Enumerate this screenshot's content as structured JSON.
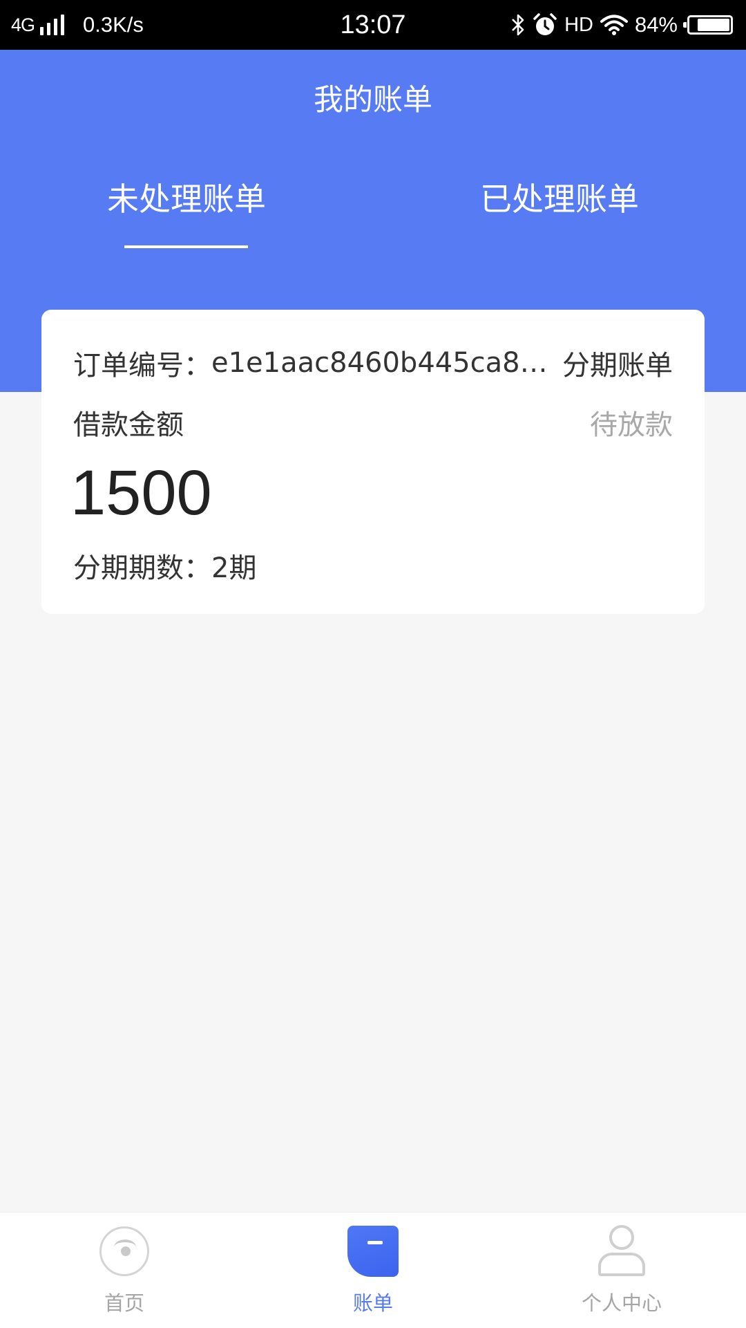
{
  "status_bar": {
    "network": "4G",
    "speed": "0.3K/s",
    "time": "13:07",
    "hd": "HD",
    "battery": "84%",
    "battery_level": 0.84
  },
  "header": {
    "title": "我的账单",
    "tabs": [
      {
        "label": "未处理账单",
        "active": true
      },
      {
        "label": "已处理账单",
        "active": false
      }
    ]
  },
  "bill_card": {
    "order_label": "订单编号：",
    "order_id": "e1e1aac8460b445ca8…",
    "order_type": "分期账单",
    "loan_label": "借款金额",
    "status": "待放款",
    "amount": "1500",
    "installment_label": "分期期数：",
    "installment_value": "2期"
  },
  "bottom_nav": {
    "items": [
      {
        "label": "首页",
        "icon": "home-eye-icon",
        "active": false
      },
      {
        "label": "账单",
        "icon": "bill-icon",
        "active": true
      },
      {
        "label": "个人中心",
        "icon": "user-icon",
        "active": false
      }
    ]
  },
  "colors": {
    "primary": "#567bf3",
    "background": "#f6f6f6",
    "muted": "#a8a8a8"
  }
}
